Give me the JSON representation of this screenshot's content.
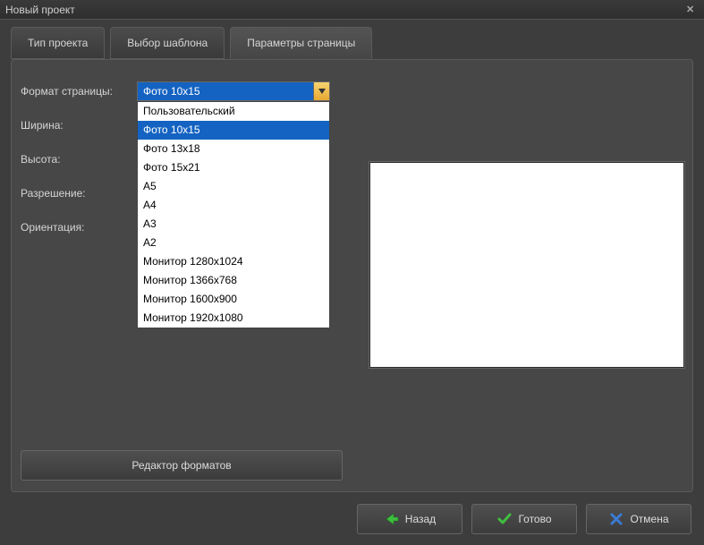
{
  "window": {
    "title": "Новый проект"
  },
  "tabs": {
    "project_type": "Тип проекта",
    "template": "Выбор шаблона",
    "page_params": "Параметры страницы"
  },
  "form": {
    "page_format_label": "Формат страницы:",
    "page_format_value": "Фото 10x15",
    "width_label": "Ширина:",
    "height_label": "Высота:",
    "resolution_label": "Разрешение:",
    "orientation_label": "Ориентация:"
  },
  "dropdown_options": [
    "Пользовательский",
    "Фото 10x15",
    "Фото 13x18",
    "Фото 15x21",
    "A5",
    "A4",
    "A3",
    "A2",
    "Монитор 1280x1024",
    "Монитор 1366x768",
    "Монитор 1600x900",
    "Монитор 1920x1080"
  ],
  "dropdown_selected_index": 1,
  "editor_button": "Редактор форматов",
  "footer": {
    "back": "Назад",
    "done": "Готово",
    "cancel": "Отмена"
  }
}
